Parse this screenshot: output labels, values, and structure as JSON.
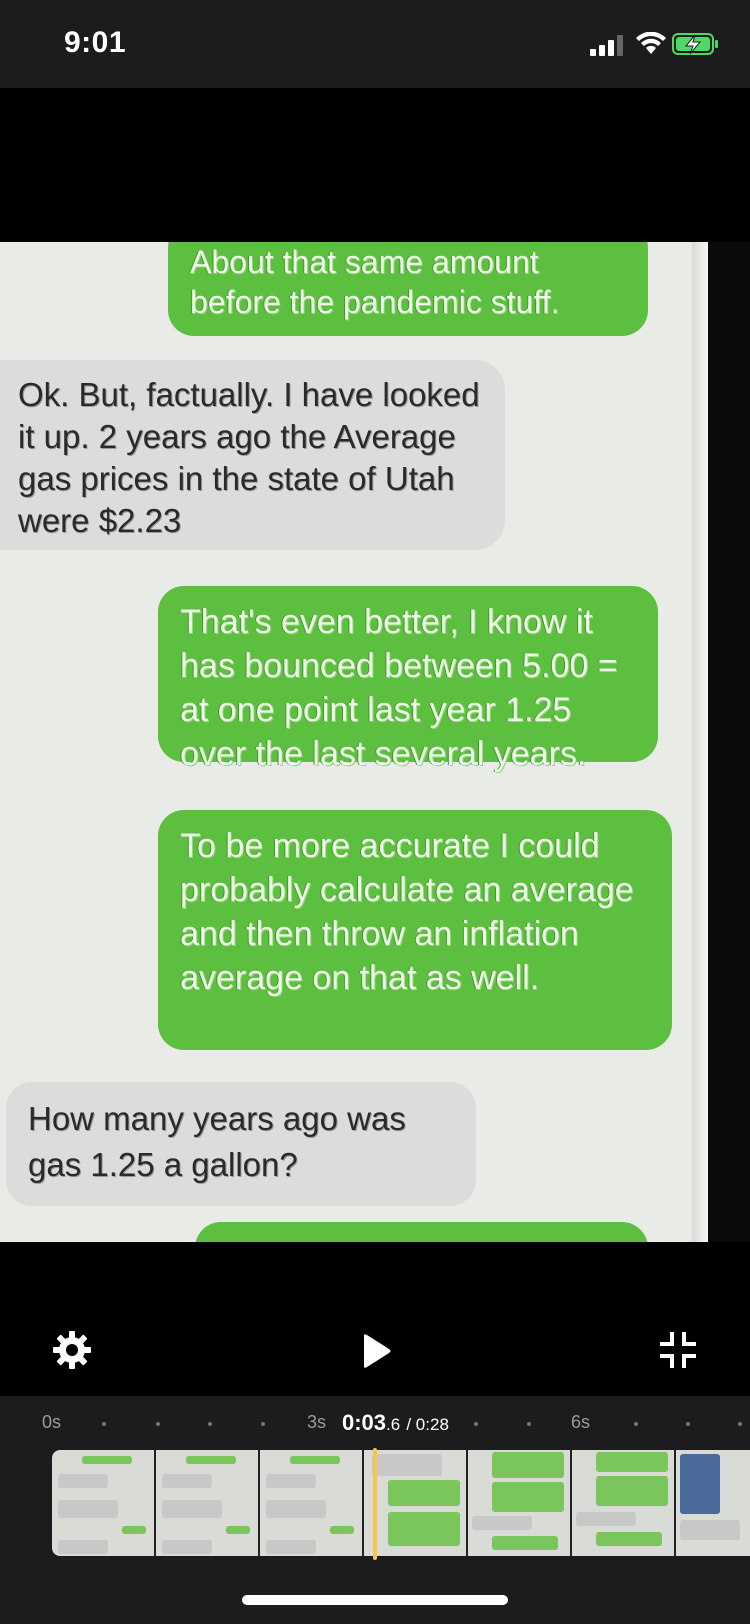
{
  "status_bar": {
    "time": "9:01",
    "icons": [
      "cellular-signal-icon",
      "wifi-icon",
      "battery-charging-icon"
    ]
  },
  "video": {
    "messages": [
      {
        "kind": "sent",
        "text": "About that same amount before the pandemic stuff."
      },
      {
        "kind": "received",
        "text": "Ok. But, factually. I have looked it up. 2 years ago the Average gas prices in the state of Utah were $2.23"
      },
      {
        "kind": "sent",
        "text": "That's even better, I know it has bounced between 5.00 = at one point last year 1.25 over the last several years."
      },
      {
        "kind": "sent",
        "text": "To be more accurate I could probably calculate an average and then throw an inflation average on that as well."
      },
      {
        "kind": "received",
        "text": "How many years ago was gas 1.25 a gallon?"
      },
      {
        "kind": "sent",
        "text": ""
      }
    ]
  },
  "controls": {
    "settings_icon": "gear-icon",
    "play_icon": "play-icon",
    "fullscreen_icon": "exit-fullscreen-icon"
  },
  "timeline": {
    "ticks": [
      "0s",
      "3s",
      "6s"
    ],
    "current_time": "0:03",
    "current_fraction": ".6",
    "total_time": "/ 0:28",
    "colors": {
      "playhead": "#f4c64a",
      "sent_bubble": "#5cbf3f",
      "received_bubble": "#dcdcdc"
    }
  }
}
